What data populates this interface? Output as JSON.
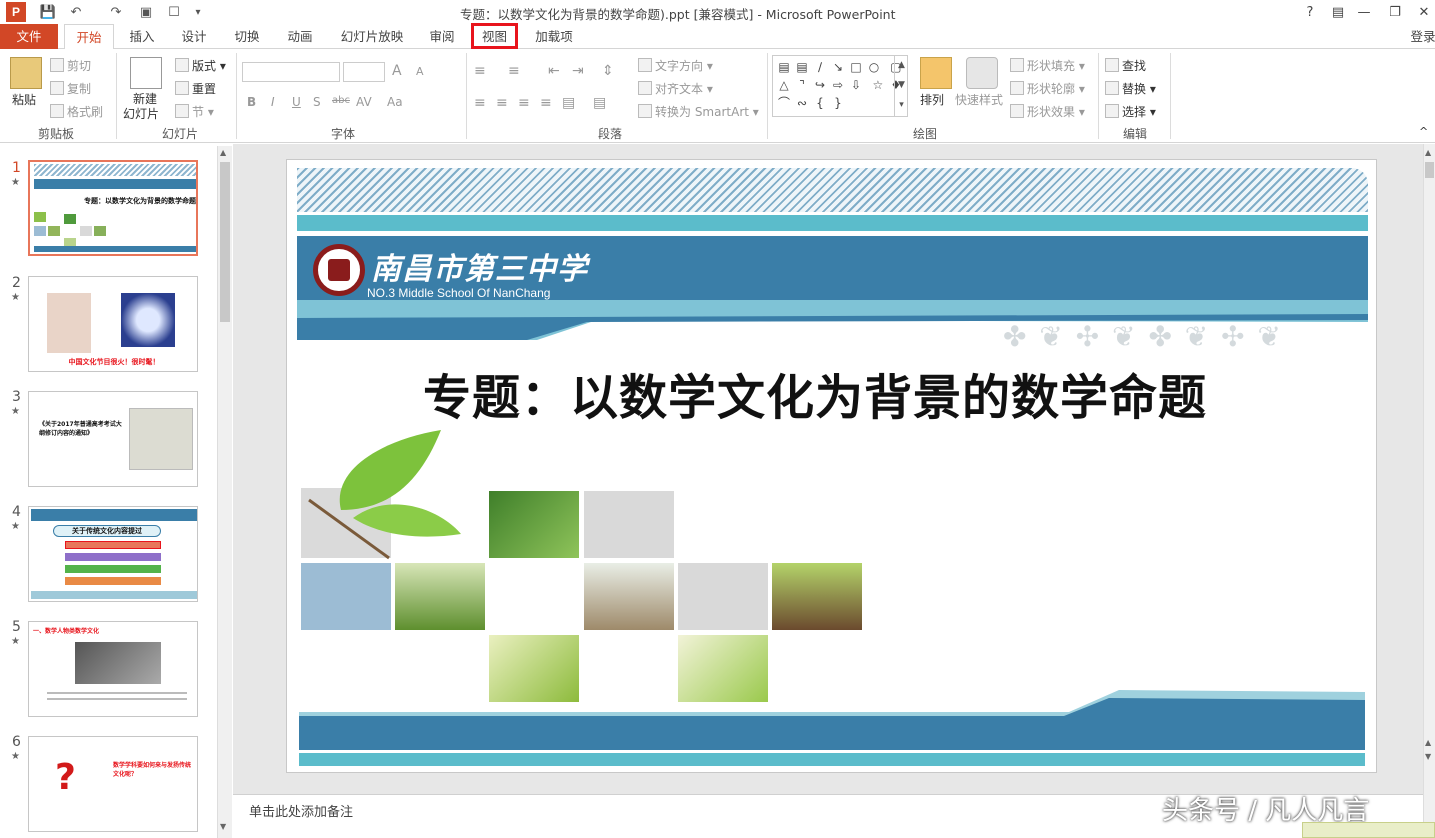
{
  "window": {
    "title": "专题：以数学文化为背景的数学命题).ppt [兼容模式] - Microsoft PowerPoint",
    "help": "?",
    "login": "登录"
  },
  "tabs": [
    {
      "label": "文件"
    },
    {
      "label": "开始"
    },
    {
      "label": "插入"
    },
    {
      "label": "设计"
    },
    {
      "label": "切换"
    },
    {
      "label": "动画"
    },
    {
      "label": "幻灯片放映"
    },
    {
      "label": "审阅"
    },
    {
      "label": "视图"
    },
    {
      "label": "加载项"
    }
  ],
  "ribbon": {
    "clipboard": {
      "paste": "粘贴",
      "cut": "剪切",
      "copy": "复制",
      "format_painter": "格式刷",
      "label": "剪贴板"
    },
    "slides": {
      "new_slide": "新建",
      "new_slide2": "幻灯片",
      "layout": "版式",
      "reset": "重置",
      "section": "节",
      "label": "幻灯片"
    },
    "font": {
      "label": "字体",
      "bold": "B",
      "italic": "I",
      "underline": "U",
      "shadow": "S",
      "strike": "abc",
      "spacing": "AV",
      "case": "Aa",
      "grow": "A",
      "shrink": "A"
    },
    "paragraph": {
      "text_direction": "文字方向",
      "align_text": "对齐文本",
      "smartart": "转换为 SmartArt",
      "label": "段落"
    },
    "drawing": {
      "arrange": "排列",
      "quick_styles": "快速样式",
      "fill": "形状填充",
      "outline": "形状轮廓",
      "effects": "形状效果",
      "label": "绘图"
    },
    "editing": {
      "find": "查找",
      "replace": "替换",
      "select": "选择",
      "label": "编辑"
    }
  },
  "thumbnails": [
    {
      "num": "1",
      "star": "★",
      "text": "专题：以数学文化为背景的数学命题"
    },
    {
      "num": "2",
      "star": "★",
      "text": "中国文化节目很火！很时髦！"
    },
    {
      "num": "3",
      "star": "★",
      "text": "《关于2017年普通高考考试大纲修订内容的通知》"
    },
    {
      "num": "4",
      "star": "★",
      "text": "关于传统文化内容提过"
    },
    {
      "num": "5",
      "star": "★",
      "text": "一、数学人物类数学文化"
    },
    {
      "num": "6",
      "star": "★",
      "text": "数学学科要如何来与发扬传统文化呢？"
    }
  ],
  "slide": {
    "school_cn": "南昌市第三中学",
    "school_en": "NO.3 Middle School  Of NanChang",
    "title": "专题：以数学文化为背景的数学命题"
  },
  "notes": {
    "placeholder": "单击此处添加备注"
  },
  "watermark": "头条号 / 凡人凡言",
  "colors": {
    "accent": "#d24726",
    "highlight": "#e8141c",
    "slide_blue": "#3a7ea8",
    "slide_teal": "#5bbccb"
  }
}
